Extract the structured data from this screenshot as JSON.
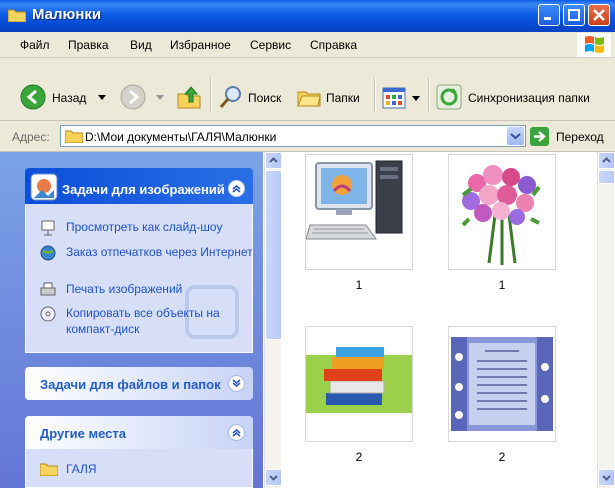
{
  "window": {
    "title": "Малюнки"
  },
  "menu": [
    "Файл",
    "Правка",
    "Вид",
    "Избранное",
    "Сервис",
    "Справка"
  ],
  "toolbar": {
    "back_label": "Назад",
    "search_label": "Поиск",
    "folders_label": "Папки",
    "sync_label": "Синхронизация папки"
  },
  "address": {
    "label": "Адрес:",
    "path": "D:\\Мои документы\\ГАЛЯ\\Малюнки",
    "go_label": "Переход"
  },
  "left_pane": {
    "image_tasks": {
      "title": "Задачи для изображений",
      "items": [
        "Просмотреть как слайд-шоу",
        "Заказ отпечатков через Интернет",
        "Печать изображений",
        "Копировать все объекты на компакт-диск"
      ]
    },
    "file_tasks": {
      "title": "Задачи для файлов и папок"
    },
    "other_places": {
      "title": "Другие места",
      "items": [
        "ГАЛЯ"
      ]
    }
  },
  "files": [
    {
      "name": "1",
      "icon": "computer-image"
    },
    {
      "name": "1",
      "icon": "flowers-image"
    },
    {
      "name": "2",
      "icon": "books-image"
    },
    {
      "name": "2",
      "icon": "poem-image"
    }
  ]
}
